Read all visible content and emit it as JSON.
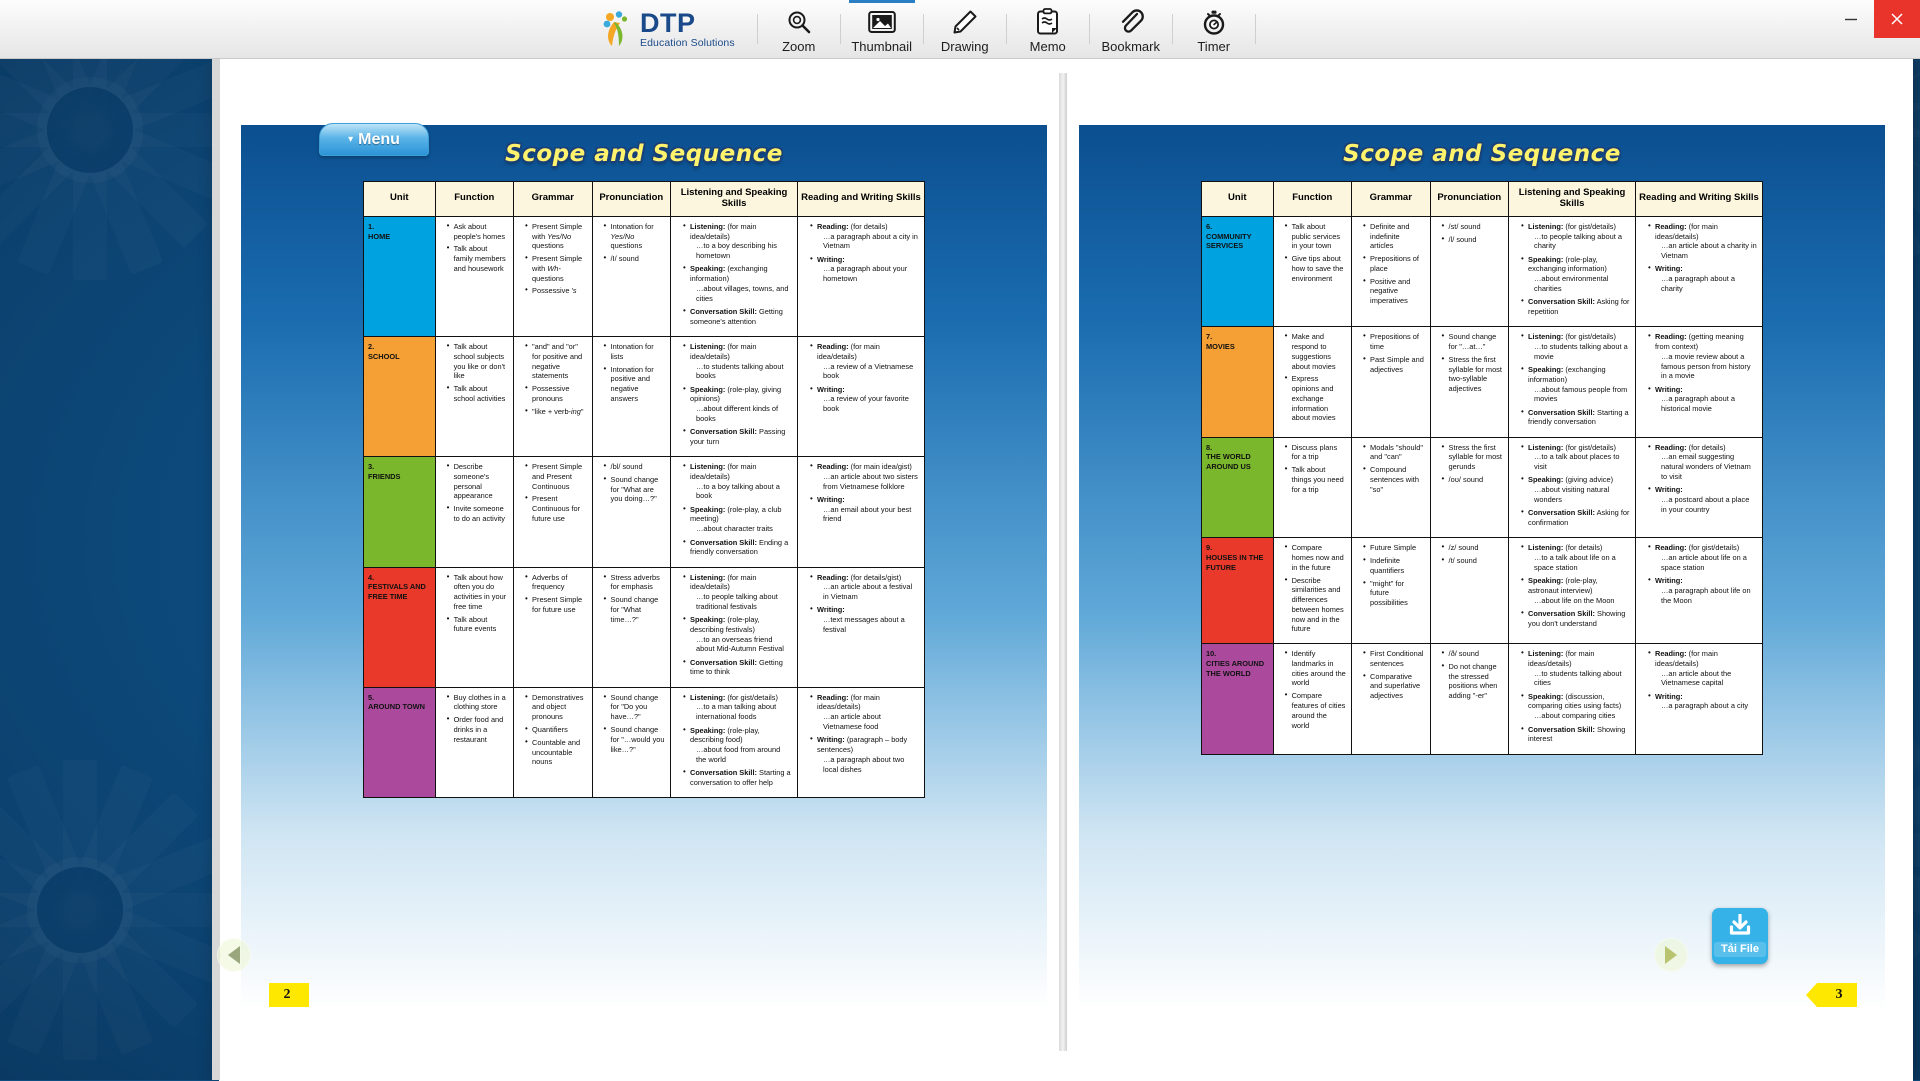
{
  "window": {
    "minimize_label": "–",
    "close_label": "✕"
  },
  "toolbar": {
    "brand_main": "DTP",
    "brand_sub": "Education Solutions",
    "items": [
      {
        "label": "Zoom",
        "icon": "magnifier-icon"
      },
      {
        "label": "Thumbnail",
        "icon": "image-icon"
      },
      {
        "label": "Drawing",
        "icon": "pencil-icon"
      },
      {
        "label": "Memo",
        "icon": "clipboard-note-icon"
      },
      {
        "label": "Bookmark",
        "icon": "paperclip-icon"
      },
      {
        "label": "Timer",
        "icon": "stopwatch-icon"
      }
    ]
  },
  "viewer": {
    "menu_tab_label": "Menu",
    "prev_page_label": "◀",
    "next_page_label": "▶",
    "download_label": "Tải File",
    "download_icon": "download-icon"
  },
  "pages": {
    "left": {
      "number": "2",
      "title": "Scope and Sequence",
      "columns": [
        "Unit",
        "Function",
        "Grammar",
        "Pronunciation",
        "Listening and Speaking Skills",
        "Reading and Writing Skills"
      ],
      "rows": [
        {
          "unit": "1.\nHOME",
          "color": "#00a3e0",
          "function": [
            "Ask about people's homes",
            "Talk about family members and housework"
          ],
          "grammar": [
            "Present Simple with <em class=\"it\">Yes/No</em> questions",
            "Present Simple with <em class=\"it\">Wh-</em> questions",
            "Possessive <em class=\"it\">'s</em>"
          ],
          "pronunciation": [
            "Intonation for <em class=\"it\">Yes/No</em> questions",
            "/I/ sound"
          ],
          "listening": [
            "<b>Listening:</b> (for main idea/details)<span class=\"ind\">…to a boy describing his hometown</span>",
            "<b>Speaking:</b> (exchanging information)<span class=\"ind\">…about villages, towns, and cities</span>",
            "<b>Conversation Skill:</b> Getting someone's attention"
          ],
          "reading": [
            "<b>Reading:</b> (for details)<span class=\"ind\">…a paragraph about a city in Vietnam</span>",
            "<b>Writing:</b><span class=\"ind\">…a paragraph about your hometown</span>"
          ]
        },
        {
          "unit": "2.\nSCHOOL",
          "color": "#f5a035",
          "function": [
            "Talk about school subjects you like or don't like",
            "Talk about school activities"
          ],
          "grammar": [
            "\"and\" and \"or\" for positive and negative statements",
            "Possessive pronouns",
            "\"like + verb-<em class=\"it\">ing</em>\""
          ],
          "pronunciation": [
            "Intonation for lists",
            "Intonation for positive and negative answers"
          ],
          "listening": [
            "<b>Listening:</b> (for main idea/details)<span class=\"ind\">…to students talking about books</span>",
            "<b>Speaking:</b> (role-play, giving opinions)<span class=\"ind\">…about different kinds of books</span>",
            "<b>Conversation Skill:</b> Passing your turn"
          ],
          "reading": [
            "<b>Reading:</b> (for main idea/details)<span class=\"ind\">…a review of a Vietnamese book</span>",
            "<b>Writing:</b><span class=\"ind\">…a review of your favorite book</span>"
          ]
        },
        {
          "unit": "3.\nFRIENDS",
          "color": "#7ab72c",
          "function": [
            "Describe someone's personal appearance",
            "Invite someone to do an activity"
          ],
          "grammar": [
            "Present Simple and Present Continuous",
            "Present Continuous for future use"
          ],
          "pronunciation": [
            "/bl/ sound",
            "Sound change for \"What are you doing…?\""
          ],
          "listening": [
            "<b>Listening:</b> (for main idea/details)<span class=\"ind\">…to a boy talking about a book</span>",
            "<b>Speaking:</b> (role-play, a club meeting)<span class=\"ind\">…about character traits</span>",
            "<b>Conversation Skill:</b> Ending a friendly conversation"
          ],
          "reading": [
            "<b>Reading:</b> (for main idea/gist)<span class=\"ind\">…an article about two sisters from Vietnamese folklore</span>",
            "<b>Writing:</b><span class=\"ind\">…an email about your best friend</span>"
          ]
        },
        {
          "unit": "4.\nFESTIVALS AND FREE TIME",
          "color": "#e8392b",
          "function": [
            "Talk about how often you do activities in your free time",
            "Talk about future events"
          ],
          "grammar": [
            "Adverbs of frequency",
            "Present Simple for future use"
          ],
          "pronunciation": [
            "Stress adverbs for emphasis",
            "Sound change for \"What time…?\""
          ],
          "listening": [
            "<b>Listening:</b> (for main idea/details)<span class=\"ind\">…to people talking about traditional festivals</span>",
            "<b>Speaking:</b> (role-play, describing festivals)<span class=\"ind\">…to an overseas friend about Mid-Autumn Festival</span>",
            "<b>Conversation Skill:</b> Getting time to think"
          ],
          "reading": [
            "<b>Reading:</b> (for details/gist)<span class=\"ind\">…an article about a festival in Vietnam</span>",
            "<b>Writing:</b><span class=\"ind\">…text messages about a festival</span>"
          ]
        },
        {
          "unit": "5.\nAROUND TOWN",
          "color": "#ab4a9c",
          "function": [
            "Buy clothes in a clothing store",
            "Order food and drinks in a restaurant"
          ],
          "grammar": [
            "Demonstratives and object pronouns",
            "Quantifiers",
            "Countable and uncountable nouns"
          ],
          "pronunciation": [
            "Sound change for \"Do you have…?\"",
            "Sound change for \"…would you like…?\""
          ],
          "listening": [
            "<b>Listening:</b> (for gist/details)<span class=\"ind\">…to a man talking about international foods</span>",
            "<b>Speaking:</b> (role-play, describing food)<span class=\"ind\">…about food from around the world</span>",
            "<b>Conversation Skill:</b> Starting a conversation to offer help"
          ],
          "reading": [
            "<b>Reading:</b> (for main ideas/details)<span class=\"ind\">…an article about Vietnamese food</span>",
            "<b>Writing:</b> (paragraph – body sentences)<span class=\"ind\">…a paragraph about two local dishes</span>"
          ]
        }
      ]
    },
    "right": {
      "number": "3",
      "title": "Scope and Sequence",
      "columns": [
        "Unit",
        "Function",
        "Grammar",
        "Pronunciation",
        "Listening and Speaking Skills",
        "Reading and Writing Skills"
      ],
      "rows": [
        {
          "unit": "6.\nCOMMUNITY SERVICES",
          "color": "#00a3e0",
          "function": [
            "Talk about public services in your town",
            "Give tips about how to save the environment"
          ],
          "grammar": [
            "Definite and indefinite articles",
            "Prepositions of place",
            "Positive and negative imperatives"
          ],
          "pronunciation": [
            "/st/ sound",
            "/l/ sound"
          ],
          "listening": [
            "<b>Listening:</b> (for gist/details)<span class=\"ind\">…to people talking about a charity</span>",
            "<b>Speaking:</b> (role-play, exchanging information)<span class=\"ind\">…about environmental charities</span>",
            "<b>Conversation Skill:</b> Asking for repetition"
          ],
          "reading": [
            "<b>Reading:</b> (for main ideas/details)<span class=\"ind\">…an article about a charity in Vietnam</span>",
            "<b>Writing:</b><span class=\"ind\">…a paragraph about a charity</span>"
          ]
        },
        {
          "unit": "7.\nMOVIES",
          "color": "#f5a035",
          "function": [
            "Make and respond to suggestions about movies",
            "Express opinions and exchange information about movies"
          ],
          "grammar": [
            "Prepositions of time",
            "Past Simple and adjectives"
          ],
          "pronunciation": [
            "Sound change for \"…at…\"",
            "Stress the first syllable for most two-syllable adjectives"
          ],
          "listening": [
            "<b>Listening:</b> (for gist/details)<span class=\"ind\">…to students talking about a movie</span>",
            "<b>Speaking:</b> (exchanging information)<span class=\"ind\">…about famous people from movies</span>",
            "<b>Conversation Skill:</b> Starting a friendly conversation"
          ],
          "reading": [
            "<b>Reading:</b> (getting meaning from context)<span class=\"ind\">…a movie review about a famous person from history in a movie</span>",
            "<b>Writing:</b><span class=\"ind\">…a paragraph about a historical movie</span>"
          ]
        },
        {
          "unit": "8.\nTHE WORLD AROUND US",
          "color": "#7ab72c",
          "function": [
            "Discuss plans for a trip",
            "Talk about things you need for a trip"
          ],
          "grammar": [
            "Modals \"should\" and \"can\"",
            "Compound sentences with \"so\""
          ],
          "pronunciation": [
            "Stress the first syllable for most gerunds",
            "/oʊ/ sound"
          ],
          "listening": [
            "<b>Listening:</b> (for gist/details)<span class=\"ind\">…to a talk about places to visit</span>",
            "<b>Speaking:</b> (giving advice)<span class=\"ind\">…about visiting natural wonders</span>",
            "<b>Conversation Skill:</b> Asking for confirmation"
          ],
          "reading": [
            "<b>Reading:</b> (for details)<span class=\"ind\">…an email suggesting natural wonders of Vietnam to visit</span>",
            "<b>Writing:</b><span class=\"ind\">…a postcard about a place in your country</span>"
          ]
        },
        {
          "unit": "9.\nHOUSES IN THE FUTURE",
          "color": "#e8392b",
          "function": [
            "Compare homes now and in the future",
            "Describe similarities and differences between homes now and in the future"
          ],
          "grammar": [
            "Future Simple",
            "Indefinite quantifiers",
            "\"might\" for future possibilities"
          ],
          "pronunciation": [
            "/z/ sound",
            "/t/ sound"
          ],
          "listening": [
            "<b>Listening:</b> (for details)<span class=\"ind\">…to a talk about life on a space station</span>",
            "<b>Speaking:</b> (role-play, astronaut interview)<span class=\"ind\">…about life on the Moon</span>",
            "<b>Conversation Skill:</b> Showing you don't understand"
          ],
          "reading": [
            "<b>Reading:</b> (for gist/details)<span class=\"ind\">…an article about life on a space station</span>",
            "<b>Writing:</b><span class=\"ind\">…a paragraph about life on the Moon</span>"
          ]
        },
        {
          "unit": "10.\nCITIES AROUND THE WORLD",
          "color": "#ab4a9c",
          "function": [
            "Identify landmarks in cities around the world",
            "Compare features of cities around the world"
          ],
          "grammar": [
            "First Conditional sentences",
            "Comparative and superlative adjectives"
          ],
          "pronunciation": [
            "/ð/ sound",
            "Do not change the stressed positions when adding \"-er\""
          ],
          "listening": [
            "<b>Listening:</b> (for main ideas/details)<span class=\"ind\">…to students talking about cities</span>",
            "<b>Speaking:</b> (discussion, comparing cities using facts)<span class=\"ind\">…about comparing cities</span>",
            "<b>Conversation Skill:</b> Showing interest"
          ],
          "reading": [
            "<b>Reading:</b> (for main ideas/details)<span class=\"ind\">…an article about the Vietnamese capital</span>",
            "<b>Writing:</b><span class=\"ind\">…a paragraph about a city</span>"
          ]
        }
      ]
    }
  }
}
